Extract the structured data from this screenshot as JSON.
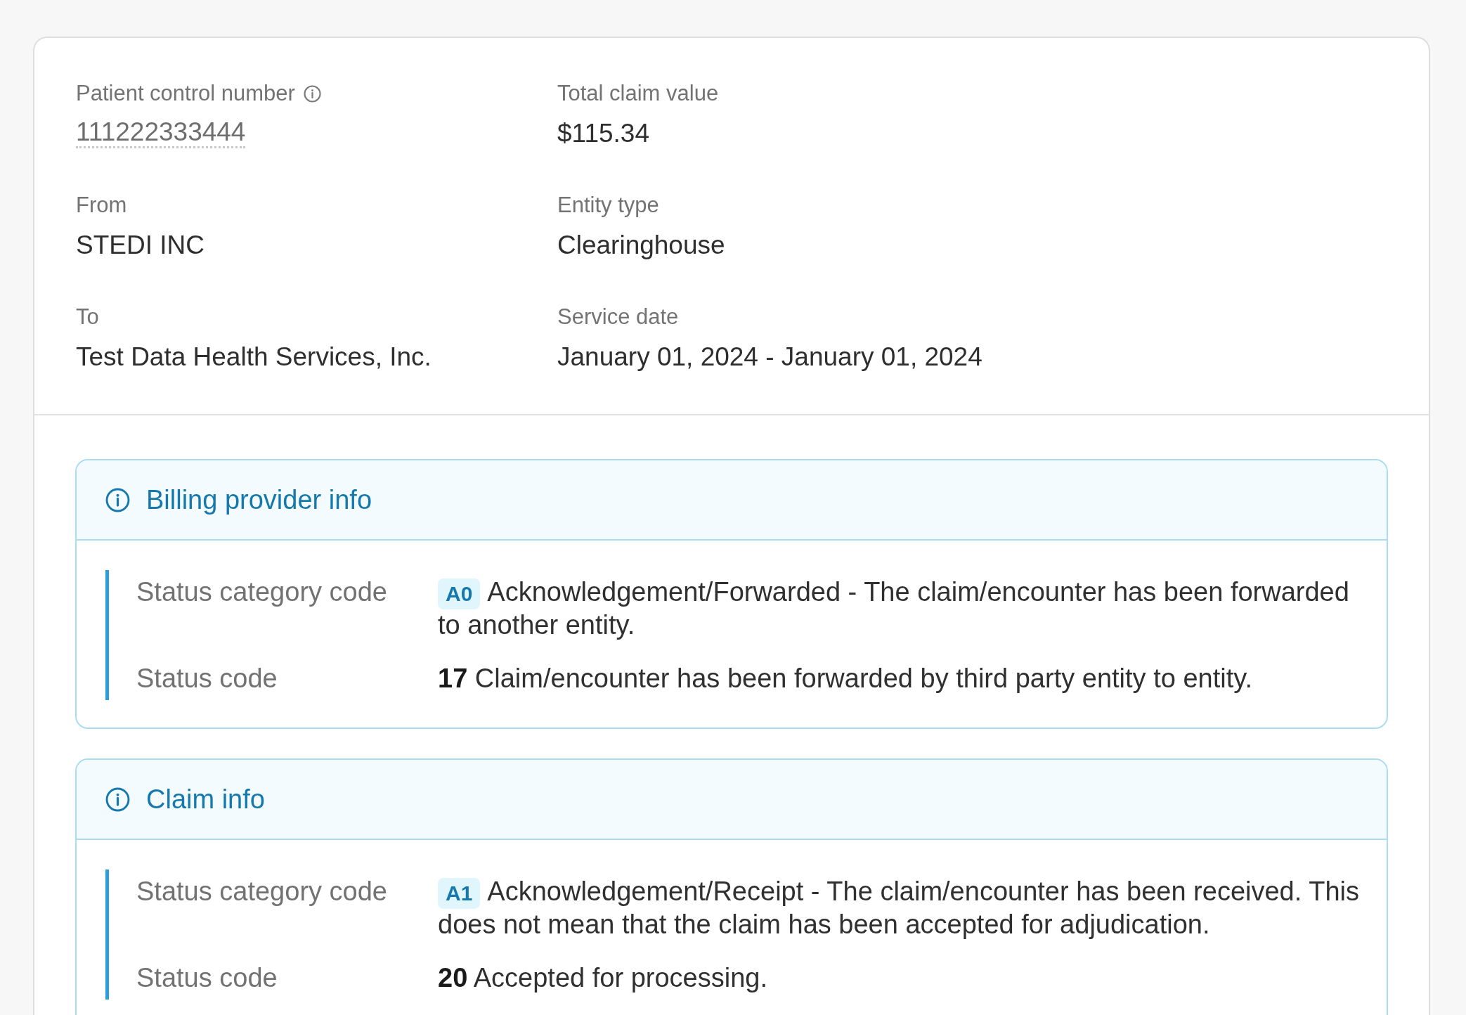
{
  "summary": {
    "fields": [
      {
        "label": "Patient control number",
        "value": "111222333444",
        "kind": "hinted"
      },
      {
        "label": "Total claim value",
        "value": "$115.34",
        "kind": "plain"
      },
      {
        "label": "From",
        "value": "STEDI INC",
        "kind": "plain"
      },
      {
        "label": "Entity type",
        "value": "Clearinghouse",
        "kind": "plain"
      },
      {
        "label": "To",
        "value": "Test Data Health Services, Inc.",
        "kind": "plain"
      },
      {
        "label": "Service date",
        "value": "January 01, 2024 - January 01, 2024",
        "kind": "plain"
      }
    ]
  },
  "sections": [
    {
      "title": "Billing provider info",
      "rows": [
        {
          "label": "Status category code",
          "kind": "badge",
          "code": "A0",
          "description": "Acknowledgement/Forwarded - The claim/encounter has been forwarded to another entity."
        },
        {
          "label": "Status code",
          "kind": "bold",
          "code": "17",
          "description": "Claim/encounter has been forwarded by third party entity to entity."
        }
      ]
    },
    {
      "title": "Claim info",
      "rows": [
        {
          "label": "Status category code",
          "kind": "badge",
          "code": "A1",
          "description": "Acknowledgement/Receipt - The claim/encounter has been received. This does not mean that the claim has been accepted for adjudication."
        },
        {
          "label": "Status code",
          "kind": "bold",
          "code": "20",
          "description": "Accepted for processing."
        }
      ]
    }
  ]
}
